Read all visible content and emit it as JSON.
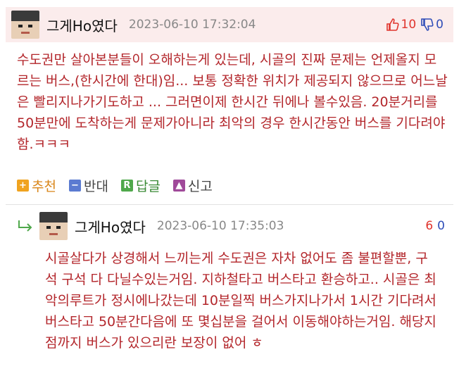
{
  "comment": {
    "author": "그게Ho였다",
    "timestamp": "2023-06-10 17:32:04",
    "upvotes": "10",
    "downvotes": "0",
    "body": "수도권만 살아본분들이 오해하는게 있는데, 시골의 진짜 문제는 언제올지 모르는 버스,(한시간에 한대)임... 보통 정확한 위치가 제공되지 않으므로 어느날은 빨리지나가기도하고 ... 그러면이제 한시간 뒤에나 볼수있음. 20분거리를 50분만에 도착하는게 문제가아니라 최악의 경우 한시간동안 버스를 기다려야함.ㅋㅋㅋ"
  },
  "actions": {
    "recommend": "추천",
    "oppose": "반대",
    "reply": "답글",
    "report": "신고"
  },
  "reply": {
    "author": "그게Ho였다",
    "timestamp": "2023-06-10 17:35:03",
    "upvotes": "6",
    "downvotes": "0",
    "body": "시골살다가 상경해서 느끼는게 수도권은 자차 없어도 좀 불편할뿐, 구석 구석 다 다닐수있는거임. 지하철타고 버스타고 환승하고.. 시골은 최악의루트가 정시에나갔는데 10분일찍 버스가지나가서 1시간 기다려서 버스타고 50분간다음에 또 몇십분을 걸어서 이동해야하는거임. 해당지점까지 버스가 있으리란 보장이 없어 ㅎ"
  },
  "colors": {
    "body_text": "#b3262b",
    "header_bg": "#fbecec",
    "upvote": "#e0342d",
    "downvote": "#2f4db8"
  },
  "icons": [
    "thumbs-up-icon",
    "thumbs-down-icon",
    "plus-icon",
    "minus-icon",
    "reply-r-icon",
    "report-icon",
    "reply-arrow-icon"
  ]
}
